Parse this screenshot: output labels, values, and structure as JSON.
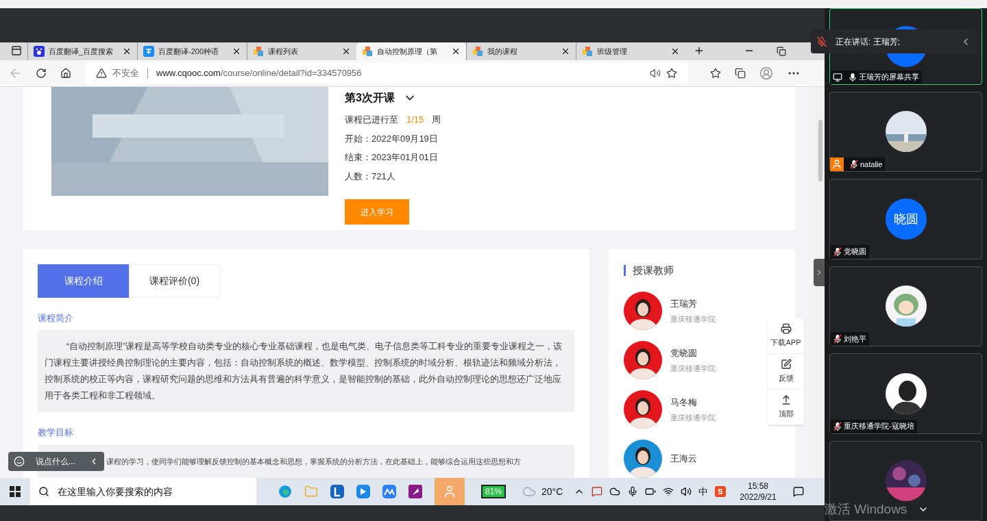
{
  "browser": {
    "tabs": [
      {
        "kind": "baidu",
        "label": "百度翻译_百度搜索",
        "selected": false
      },
      {
        "kind": "translate",
        "label": "百度翻译-200种语",
        "selected": false
      },
      {
        "kind": "course",
        "label": "课程列表",
        "selected": false
      },
      {
        "kind": "course",
        "label": "自动控制原理（第",
        "selected": true
      },
      {
        "kind": "course",
        "label": "我的课程",
        "selected": false
      },
      {
        "kind": "course",
        "label": "班级管理",
        "selected": false
      }
    ],
    "security": "不安全",
    "url_host": "www.cqooc.com",
    "url_path": "/course/online/detail?id=334570956"
  },
  "course": {
    "session": "第3次开课",
    "progress_label": "课程已进行至",
    "progress": "1/15",
    "progress_unit": "周",
    "facts": [
      "开始：2022年09月19日",
      "结束：2023年01月01日",
      "人数：721人"
    ],
    "enter_button": "进入学习"
  },
  "intro": {
    "tabs": [
      {
        "label": "课程介绍",
        "selected": true
      },
      {
        "label": "课程评价(0)",
        "selected": false
      }
    ],
    "sections": [
      {
        "heading": "课程简介",
        "body": "“自动控制原理”课程是高等学校自动类专业的核心专业基础课程，也是电气类、电子信息类等工科专业的重要专业课程之一，该门课程主要讲授经典控制理论的主要内容，包括：自动控制系统的概述、数学模型、控制系统的时域分析、根轨迹法和频域分析法，控制系统的校正等内容，课程研究问题的思维和方法具有普遍的科学意义，是智能控制的基础，此外自动控制理论的思想还广泛地应用于各类工程和非工程领域。"
      },
      {
        "heading": "教学目标",
        "body": "课程的学习，使同学们能够理解反馈控制的基本概念和思想，掌握系统的分析方法，在此基础上，能够综合运用这些思想和方"
      }
    ]
  },
  "teachers": {
    "title": "授课教师",
    "items": [
      {
        "name": "王瑞芳",
        "school": "重庆移通学院"
      },
      {
        "name": "党晓圆",
        "school": "重庆移通学院"
      },
      {
        "name": "马冬梅",
        "school": "重庆移通学院"
      },
      {
        "name": "王海云"
      }
    ]
  },
  "float_menu": [
    {
      "kind": "app",
      "label": "下载APP"
    },
    {
      "kind": "feedback",
      "label": "反馈"
    },
    {
      "kind": "top",
      "label": "顶部"
    }
  ],
  "danmaku": {
    "placeholder": "说点什么..."
  },
  "taskbar": {
    "search_placeholder": "在这里输入你要搜索的内容",
    "battery": "81%",
    "weather": "20°C",
    "ime": "中",
    "time": "15:58",
    "date": "2022/9/21",
    "activation": "激活 Windows"
  },
  "meeting": {
    "speaking": "正在讲话: 王瑞芳;",
    "tiles": [
      {
        "kind": "screen",
        "label": "王瑞芳的屏幕共享",
        "muted": false
      },
      {
        "kind": "picture",
        "label": "natalie",
        "muted": true,
        "host": true
      },
      {
        "kind": "initials",
        "initials": "晓圆",
        "label": "党晓圆",
        "muted": true,
        "host": false
      },
      {
        "kind": "picture",
        "label": "刘艳平",
        "muted": true,
        "host": false
      },
      {
        "kind": "picture",
        "label": "重庆移通学院-寇晓培",
        "muted": true,
        "host": false
      },
      {
        "kind": "picture"
      }
    ]
  }
}
